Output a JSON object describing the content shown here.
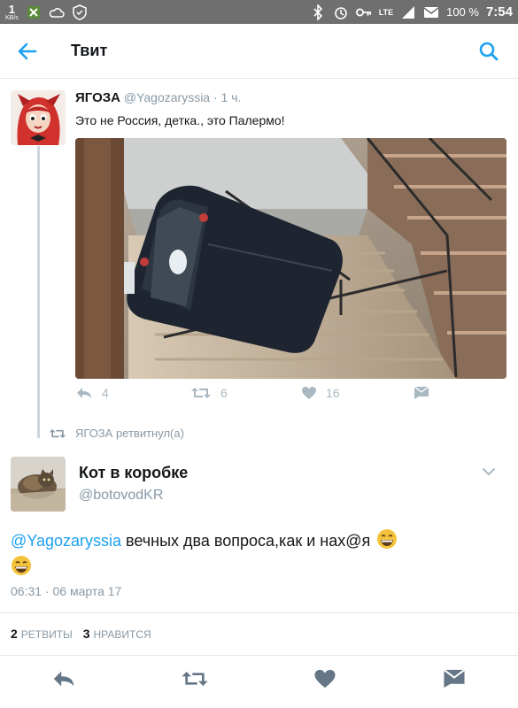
{
  "status_bar": {
    "speed_value": "1",
    "speed_unit": "KB/s",
    "network": "LTE",
    "battery": "100 %",
    "time": "7:54",
    "icons": [
      "xbox-icon",
      "cloud-icon",
      "shield-icon",
      "bluetooth-icon",
      "alarm-icon",
      "key-icon",
      "signal-icon",
      "message-icon"
    ]
  },
  "header": {
    "title": "Твит",
    "back_icon": "arrow-left-icon",
    "search_icon": "search-icon",
    "accent": "#1da1f2"
  },
  "quoted_tweet": {
    "name": "ЯГОЗА",
    "handle_time": "@Yagozaryssia · 1 ч.",
    "text": "Это не Россия, детка., это Палермо!",
    "replies": "4",
    "retweets": "6",
    "likes": "16"
  },
  "retweet_note": {
    "text": "ЯГОЗА ретвитнул(а)"
  },
  "main_tweet": {
    "name": "Кот в коробке",
    "handle": "@botovodKR",
    "mention": "@Yagozaryssia",
    "text": " вечных два вопроса,как и нах@я ",
    "timestamp": "06:31 · 06 марта 17"
  },
  "stats": {
    "retweets_count": "2",
    "retweets_label": "РЕТВИТЫ",
    "likes_count": "3",
    "likes_label": "НРАВИТСЯ"
  },
  "colors": {
    "muted": "#8899a6",
    "icon_muted": "#aab8c2",
    "divider": "#e1e8ed",
    "link": "#1da1f2"
  }
}
